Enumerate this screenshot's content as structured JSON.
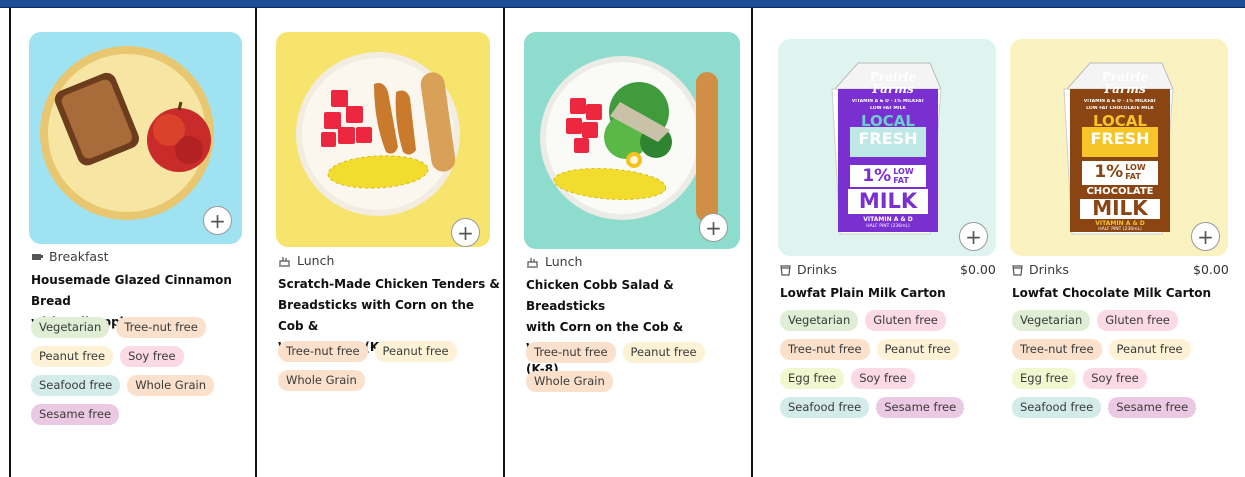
{
  "cards": [
    {
      "meal": "Breakfast",
      "title_lines": [
        "Housemade Glazed Cinnamon Bread",
        "with Fuji Apple"
      ],
      "tags": [
        {
          "label": "Vegetarian",
          "color": "#dfeed4"
        },
        {
          "label": "Tree-nut free",
          "color": "#fbe0cc"
        },
        {
          "label": "Peanut free",
          "color": "#fdf2d6"
        },
        {
          "label": "Soy free",
          "color": "#fbd9e5"
        },
        {
          "label": "Seafood free",
          "color": "#d3ece9"
        },
        {
          "label": "Whole Grain",
          "color": "#fbe0cc"
        },
        {
          "label": "Sesame free",
          "color": "#ecc9e3"
        }
      ],
      "image_bg": "#9fe2f2"
    },
    {
      "meal": "Lunch",
      "title_lines": [
        "Scratch-Made Chicken Tenders &",
        "Breadsticks with Corn on the Cob &",
        "Watermelon (K-8)"
      ],
      "tags": [
        {
          "label": "Tree-nut free",
          "color": "#fbe0cc"
        },
        {
          "label": "Peanut free",
          "color": "#fdf2d6"
        },
        {
          "label": "Whole Grain",
          "color": "#fbe0cc"
        }
      ],
      "image_bg": "#f7e46c"
    },
    {
      "meal": "Lunch",
      "title_lines": [
        "Chicken Cobb Salad & Breadsticks",
        "with Corn on the Cob & Watermelon",
        "(K-8)"
      ],
      "tags": [
        {
          "label": "Tree-nut free",
          "color": "#fbe0cc"
        },
        {
          "label": "Peanut free",
          "color": "#fdf2d6"
        },
        {
          "label": "Whole Grain",
          "color": "#fbe0cc"
        }
      ],
      "image_bg": "#8edccd"
    },
    {
      "meal": "Drinks",
      "price": "$0.00",
      "title_lines": [
        "Lowfat Plain Milk Carton"
      ],
      "tags": [
        {
          "label": "Vegetarian",
          "color": "#dfeed4"
        },
        {
          "label": "Gluten free",
          "color": "#fbd9e5"
        },
        {
          "label": "Tree-nut free",
          "color": "#fbe0cc"
        },
        {
          "label": "Peanut free",
          "color": "#fdf2d6"
        },
        {
          "label": "Egg free",
          "color": "#f1f7cf"
        },
        {
          "label": "Soy free",
          "color": "#fbd9e5"
        },
        {
          "label": "Seafood free",
          "color": "#d3ece9"
        },
        {
          "label": "Sesame free",
          "color": "#ecc9e3"
        }
      ],
      "image_bg": "#dff4ee",
      "carton": {
        "brand_lines": [
          "Prairie",
          "Farms"
        ],
        "vitamin_top": "VITAMIN A & D · 1% MILKFAT",
        "fat_sub": "LOW FAT MILK",
        "local": "LOCAL",
        "fresh": "FRESH",
        "percent": "1%",
        "low": "LOW",
        "fat": "FAT",
        "product": "MILK",
        "vitamin": "VITAMIN A & D",
        "pint": "HALF PINT (236mL)",
        "color": "#7a2fd0"
      }
    },
    {
      "meal": "Drinks",
      "price": "$0.00",
      "title_lines": [
        "Lowfat Chocolate Milk Carton"
      ],
      "tags": [
        {
          "label": "Vegetarian",
          "color": "#dfeed4"
        },
        {
          "label": "Gluten free",
          "color": "#fbd9e5"
        },
        {
          "label": "Tree-nut free",
          "color": "#fbe0cc"
        },
        {
          "label": "Peanut free",
          "color": "#fdf2d6"
        },
        {
          "label": "Egg free",
          "color": "#f1f7cf"
        },
        {
          "label": "Soy free",
          "color": "#fbd9e5"
        },
        {
          "label": "Seafood free",
          "color": "#d3ece9"
        },
        {
          "label": "Sesame free",
          "color": "#ecc9e3"
        }
      ],
      "image_bg": "#fbf2c2",
      "carton": {
        "brand_lines": [
          "Prairie",
          "Farms"
        ],
        "vitamin_top": "VITAMIN A & D · 1% MILKFAT",
        "fat_sub": "LOW FAT CHOCOLATE MILK",
        "local": "LOCAL",
        "fresh": "FRESH",
        "percent": "1%",
        "low": "LOW",
        "fat": "FAT",
        "flavor": "CHOCOLATE",
        "product": "MILK",
        "vitamin": "VITAMIN A & D",
        "pint": "HALF PINT (236mL)",
        "color": "#8a4512"
      }
    }
  ],
  "add_symbol": "+"
}
